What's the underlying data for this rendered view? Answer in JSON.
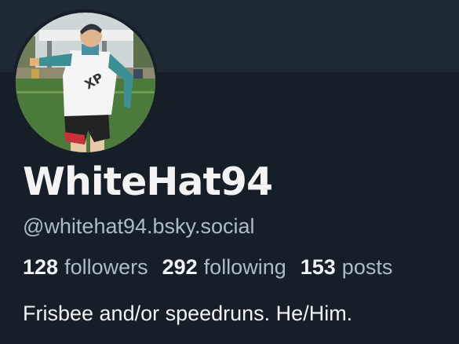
{
  "profile": {
    "display_name": "WhiteHat94",
    "handle": "@whitehat94.bsky.social",
    "bio": "Frisbee and/or speedruns. He/Him.",
    "avatar_icon": "avatar-photo"
  },
  "stats": {
    "followers": {
      "count": "128",
      "label": "followers"
    },
    "following": {
      "count": "292",
      "label": "following"
    },
    "posts": {
      "count": "153",
      "label": "posts"
    }
  },
  "colors": {
    "background": "#161e27",
    "banner": "#1e2935",
    "text_primary": "#f1f3f5",
    "text_secondary": "#aebbc9"
  }
}
